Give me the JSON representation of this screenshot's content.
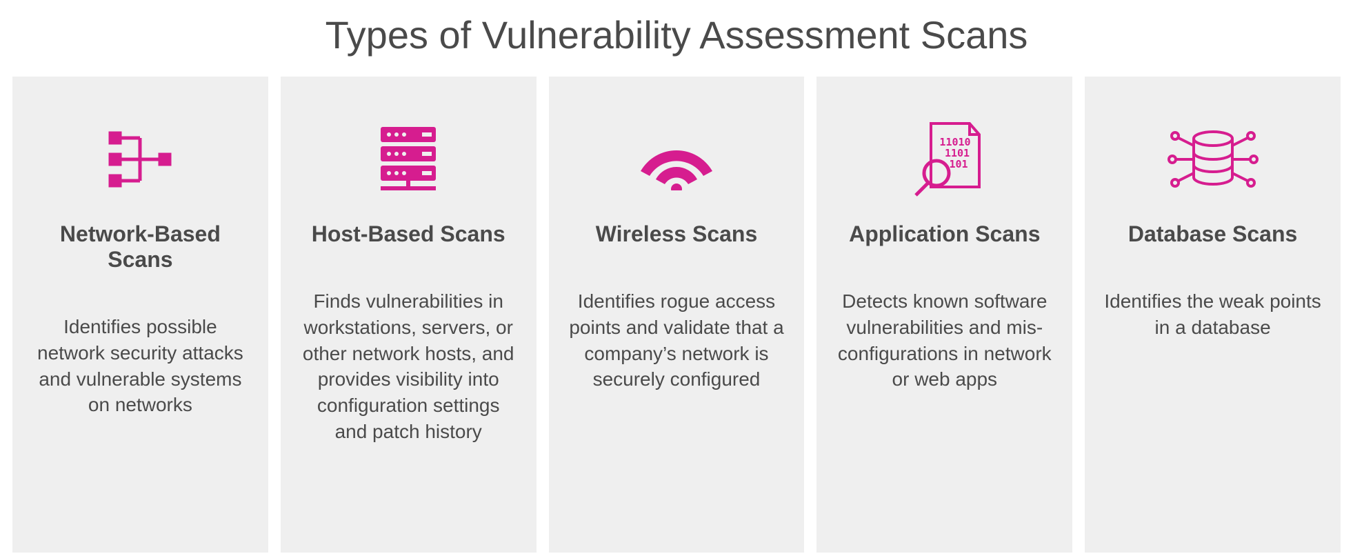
{
  "title": "Types of Vulnerability Assessment Scans",
  "accent": "#d61d8f",
  "cards": [
    {
      "icon": "network-icon",
      "title": "Network-Based Scans",
      "desc": "Identifies possible network security attacks and vulnerable systems on networks"
    },
    {
      "icon": "host-icon",
      "title": "Host-Based Scans",
      "desc": "Finds vulnerabilities in workstations, servers, or other network hosts, and provides visibility into configuration settings and patch history"
    },
    {
      "icon": "wireless-icon",
      "title": "Wireless Scans",
      "desc": "Identifies rogue access points and validate that a company’s network is securely configured"
    },
    {
      "icon": "application-icon",
      "title": "Application Scans",
      "desc": "Detects known software vulnerabilities and mis-configurations in network or web apps"
    },
    {
      "icon": "database-icon",
      "title": "Database Scans",
      "desc": "Identifies the weak points in a database"
    }
  ]
}
